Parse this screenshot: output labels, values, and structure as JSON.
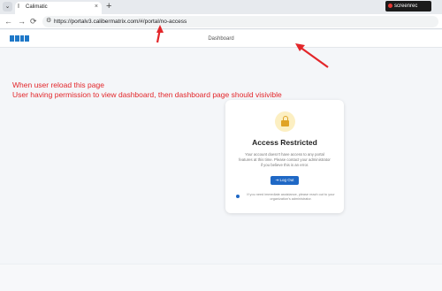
{
  "browser": {
    "tab_title": "Calimatic",
    "tab_favicon": "I",
    "tab_close": "×",
    "new_tab": "+",
    "menu_glyph": "⌄",
    "back": "←",
    "forward": "→",
    "reload": "⟳",
    "url": "https://portalv3.calibermatrix.com/#/portal/no-access",
    "screenrec_label": "screenrec"
  },
  "app": {
    "page_title": "Dashboard"
  },
  "annotation": {
    "line1": "When user reload this page",
    "line2": "User having permission to view dashboard, then dashboard page should visivible",
    "color": "#e3262a"
  },
  "card": {
    "title": "Access Restricted",
    "message": "Your account doesn't have access to any portal features at this time. Please contact your administrator if you believe this is an error.",
    "logout_label": "Log Out",
    "logout_icon": "⇥",
    "help_text": "If you need immediate assistance, please reach out to your organization's administrator."
  },
  "colors": {
    "accent": "#1f68c5",
    "lock_bg": "#fcefc2",
    "lock": "#e0a326"
  }
}
